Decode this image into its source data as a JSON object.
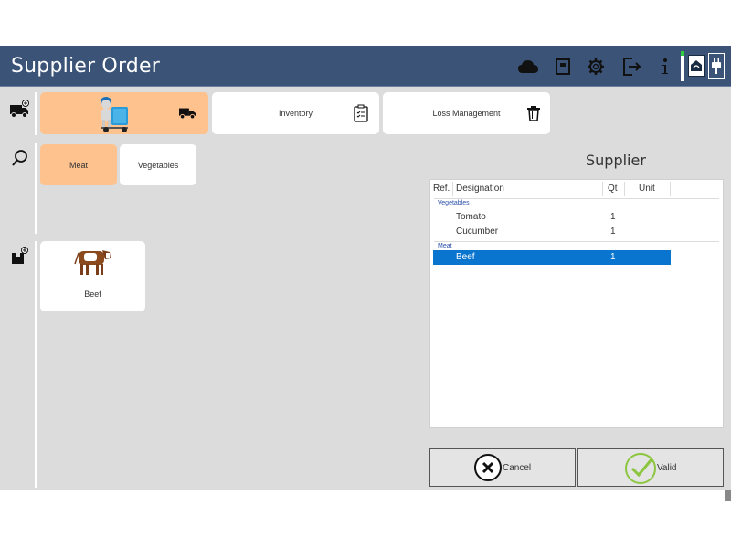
{
  "header": {
    "title": "Supplier Order",
    "icons": [
      "cloud-icon",
      "register-icon",
      "gear-icon",
      "logout-icon",
      "info-icon",
      "connection-icon",
      "plug-icon"
    ]
  },
  "sidebar_icons": [
    "new-order-truck-icon",
    "search-icon",
    "add-product-icon"
  ],
  "top_cards": [
    {
      "label": "",
      "icon": "truck-icon",
      "active": true
    },
    {
      "label": "Inventory",
      "icon": "clipboard-icon"
    },
    {
      "label": "Loss Management",
      "icon": "trash-icon"
    }
  ],
  "categories": [
    {
      "label": "Meat",
      "active": true
    },
    {
      "label": "Vegetables"
    }
  ],
  "products": [
    {
      "label": "Beef",
      "image": "cow-image"
    }
  ],
  "supplier": {
    "title": "Supplier",
    "columns": [
      "Ref.",
      "Designation",
      "Qt",
      "Unit"
    ],
    "groups": [
      {
        "name": "Vegetables",
        "rows": [
          {
            "ref": "",
            "designation": "Tomato",
            "qt": "1",
            "unit": ""
          },
          {
            "ref": "",
            "designation": "Cucumber",
            "qt": "1",
            "unit": ""
          }
        ]
      },
      {
        "name": "Meat",
        "rows": [
          {
            "ref": "",
            "designation": "Beef",
            "qt": "1",
            "unit": "",
            "selected": true
          }
        ]
      }
    ]
  },
  "actions": {
    "cancel_label": "Cancel",
    "valid_label": "Valid"
  },
  "colors": {
    "header": "#3a5377",
    "background": "#dcdcdc",
    "active_card": "#fdc28e",
    "selection": "#0a75cf",
    "group_label": "#2b4fa8",
    "valid_green": "#8cc63f"
  }
}
